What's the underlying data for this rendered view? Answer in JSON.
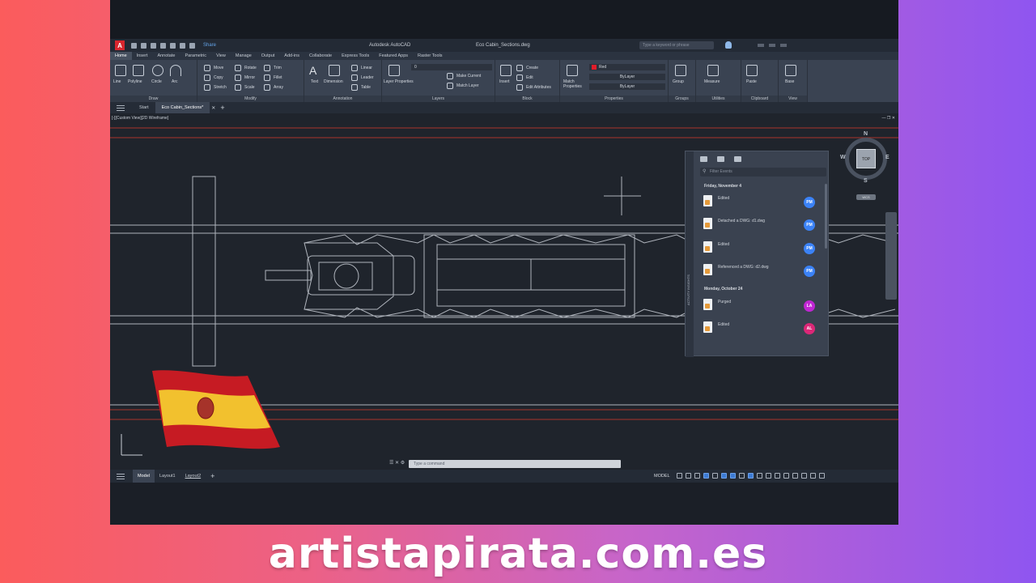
{
  "app": {
    "title": "Autodesk AutoCAD",
    "document": "Eco Cabin_Sections.dwg",
    "share_label": "Share",
    "search_placeholder": "Type a keyword or phrase",
    "logo_letter": "A"
  },
  "ribbon_tabs": [
    "Home",
    "Insert",
    "Annotate",
    "Parametric",
    "View",
    "Manage",
    "Output",
    "Add-ins",
    "Collaborate",
    "Express Tools",
    "Featured Apps",
    "Raster Tools"
  ],
  "ribbon_panels": {
    "draw": {
      "title": "Draw",
      "tools": [
        "Line",
        "Polyline",
        "Circle",
        "Arc"
      ]
    },
    "modify": {
      "title": "Modify",
      "tools": [
        "Move",
        "Rotate",
        "Trim",
        "Copy",
        "Mirror",
        "Fillet",
        "Stretch",
        "Scale",
        "Array"
      ]
    },
    "annotation": {
      "title": "Annotation",
      "tools": [
        "Text",
        "Dimension",
        "Linear",
        "Leader",
        "Table"
      ]
    },
    "layers": {
      "title": "Layers",
      "tools": [
        "Layer Properties",
        "Make Current",
        "Match Layer"
      ],
      "layer_value": "0"
    },
    "block": {
      "title": "Block",
      "tools": [
        "Insert",
        "Create",
        "Edit",
        "Edit Attributes"
      ]
    },
    "properties": {
      "title": "Properties",
      "tools": [
        "Match Properties"
      ],
      "color": "Red",
      "linetype": "ByLayer",
      "lineweight": "ByLayer"
    },
    "groups": {
      "title": "Groups",
      "tools": [
        "Group"
      ]
    },
    "utilities": {
      "title": "Utilities",
      "tools": [
        "Measure"
      ]
    },
    "clipboard": {
      "title": "Clipboard",
      "tools": [
        "Paste"
      ]
    },
    "view": {
      "title": "View",
      "tools": [
        "Base"
      ]
    }
  },
  "file_tabs": [
    "Start",
    "Eco Cabin_Sections*"
  ],
  "viewport": {
    "label": "[-][Custom View][2D Wireframe]",
    "controls": "— ❐ ✕"
  },
  "activity": {
    "title": "ACTIVITY INSIGHTS",
    "filter_placeholder": "Filter Events",
    "groups": [
      {
        "date": "Friday, November 4",
        "items": [
          {
            "text": "Edited",
            "initials": "PM",
            "color": "#3b82f6"
          },
          {
            "text": "Detached a DWG: d1.dwg",
            "initials": "PM",
            "color": "#3b82f6"
          },
          {
            "text": "Edited",
            "initials": "PM",
            "color": "#3b82f6"
          },
          {
            "text": "Referenced a DWG: d2.dwg",
            "initials": "PM",
            "color": "#3b82f6"
          }
        ]
      },
      {
        "date": "Monday, October 24",
        "items": [
          {
            "text": "Purged",
            "initials": "LA",
            "color": "#c026d3"
          },
          {
            "text": "Edited",
            "initials": "AL",
            "color": "#db2777"
          }
        ]
      }
    ]
  },
  "viewcube": {
    "top": "TOP",
    "n": "N",
    "s": "S",
    "e": "E",
    "w": "W",
    "wcs": "WCS"
  },
  "command": {
    "placeholder": "Type a command"
  },
  "layout_tabs": [
    "Model",
    "Layout1",
    "Layout2"
  ],
  "status": {
    "model": "MODEL"
  },
  "footer": {
    "site": "artistapirata.com.es"
  }
}
